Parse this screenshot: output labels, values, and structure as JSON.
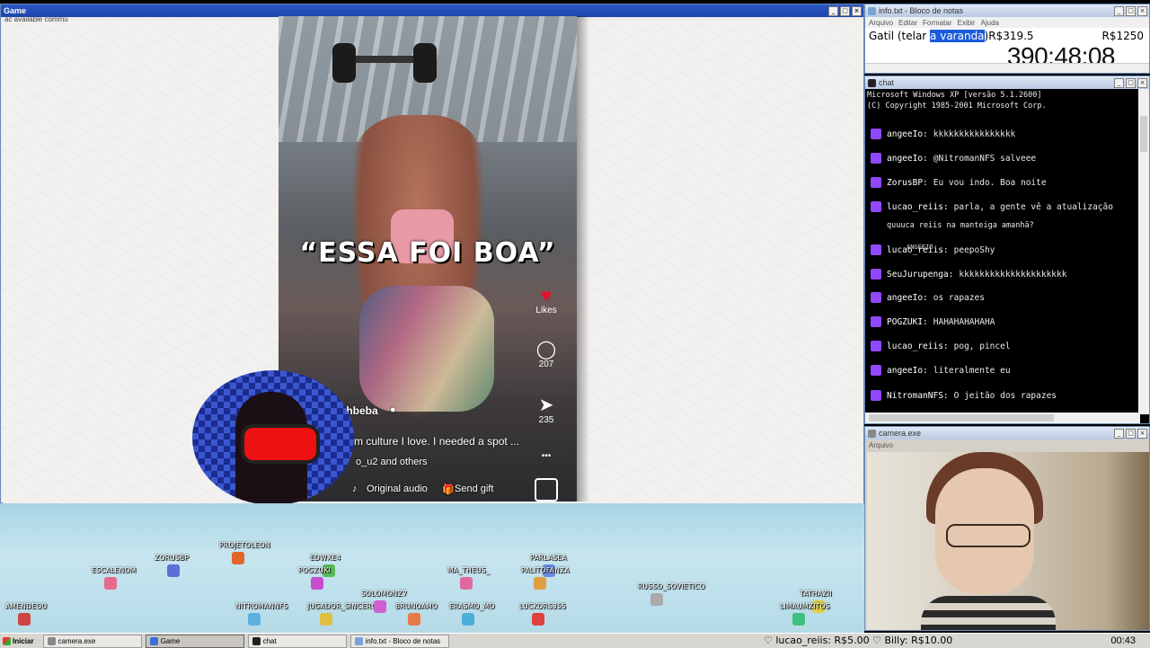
{
  "game_window": {
    "title": "Game",
    "overlay_text": "ac available commu",
    "caption": "“ESSA FOI BOA”",
    "likes_label": "Likes",
    "comments_count": "207",
    "shares_count": "235",
    "more_label": "•••",
    "author": "ithbeba",
    "description": "m culture I love. I needed a spot ...",
    "liked_by": "o_u2 and others",
    "audio_label": "Original audio",
    "gift_label": "Send gift"
  },
  "notepad": {
    "title": "info.txt - Bloco de notas",
    "menu": [
      "Arquivo",
      "Editar",
      "Formatar",
      "Exibir",
      "Ajuda"
    ],
    "line_prefix": "Gatil (telar ",
    "line_selected": "a varanda",
    "line_suffix": ")R$319.5",
    "right_value": "R$1250",
    "timer": "390:48:08"
  },
  "chat_window": {
    "title": "chat",
    "header_line1": "Microsoft Windows XP [versão 5.1.2600]",
    "header_line2": "(C) Copyright 1985-2001 Microsoft Corp.",
    "messages": [
      {
        "user": "angeeIo:",
        "text": "kkkkkkkkkkkkkkkk"
      },
      {
        "user": "angeeIo:",
        "text": "@NitromanNFS salveee"
      },
      {
        "user": "ZorusBP:",
        "text": "Eu vou indo. Boa noite"
      },
      {
        "user": "lucao_reiis:",
        "text": "parla, a gente vê a atualização"
      },
      {
        "user": "",
        "text": "quuuca reiis na manteiga amanhã?"
      },
      {
        "user": "lucao_reiis:",
        "text": "peepoShy"
      },
      {
        "user": "SeuJurupenga:",
        "text": "kkkkkkkkkkkkkkkkkkkkk"
      },
      {
        "user": "angeeIo:",
        "text": "os rapazes"
      },
      {
        "user": "POGZUKI:",
        "text": "HAHAHAHAHAHA"
      },
      {
        "user": "lucao_reiis:",
        "text": "pog, pincel"
      },
      {
        "user": "angeeIo:",
        "text": "literalmente eu"
      },
      {
        "user": "NitromanNFS:",
        "text": "O jeitão dos rapazes"
      }
    ],
    "floating_tag": "ANGEEIO"
  },
  "camera_window": {
    "title": "camera.exe",
    "menu": "Arquivo"
  },
  "stream_names": [
    "PROJETOLEON",
    "ESCALENOM",
    "ZORUSBP",
    "EDWXE4",
    "POGZUKI",
    "MA_THEUS_",
    "PARLASEA",
    "PALITOFANZA",
    "RUSSO_SOVIETICO",
    "AMENDEOU",
    "NITROMANNFS",
    "JUGADOR_SINCERO",
    "SOLOMONZ7",
    "BRUNOAMO",
    "ERASMO_MO",
    "LUCKORS355",
    "TATHAZII",
    "LIMAUMZITOS"
  ],
  "taskbar": {
    "start": "Iniciar",
    "items": [
      "camera.exe",
      "Game",
      "chat",
      "info.txt - Bloco de notas"
    ],
    "ticker": "♡ lucao_reiis: R$5.00 ♡ Billy: R$10.00",
    "clock": "00:43"
  },
  "colors": {
    "twitch_badge": "#9147ff",
    "selection": "#1c5bdb",
    "title_active": "#2a58c8"
  }
}
